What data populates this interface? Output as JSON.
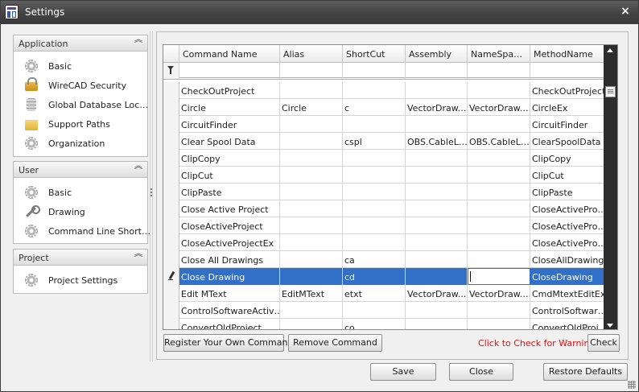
{
  "window": {
    "title": "Settings",
    "close_glyph": "×"
  },
  "sidebar": {
    "groups": [
      {
        "title": "Application",
        "items": [
          {
            "label": "Basic",
            "icon": "gear-icon"
          },
          {
            "label": "WireCAD Security",
            "icon": "lock-icon"
          },
          {
            "label": "Global Database Loc…",
            "icon": "database-icon"
          },
          {
            "label": "Support Paths",
            "icon": "folder-icon"
          },
          {
            "label": "Organization",
            "icon": "gear-icon"
          }
        ]
      },
      {
        "title": "User",
        "items": [
          {
            "label": "Basic",
            "icon": "gear-icon"
          },
          {
            "label": "Drawing",
            "icon": "wrench-icon"
          },
          {
            "label": "Command Line Short…",
            "icon": "gear-icon"
          }
        ]
      },
      {
        "title": "Project",
        "items": [
          {
            "label": "Project Settings",
            "icon": "gear-icon"
          }
        ]
      }
    ],
    "collapse_glyph": "︽"
  },
  "grid": {
    "columns": [
      "Command Name",
      "Alias",
      "ShortCut",
      "Assembly",
      "NameSpa…",
      "MethodName"
    ],
    "rows": [
      [
        "CheckOutProject",
        "",
        "",
        "",
        "",
        "CheckOutProject"
      ],
      [
        "Circle",
        "Circle",
        "c",
        "VectorDraw.…",
        "VectorDraw.…",
        "CircleEx"
      ],
      [
        "CircuitFinder",
        "",
        "",
        "",
        "",
        "CircuitFinder"
      ],
      [
        "Clear Spool Data",
        "",
        "cspl",
        "OBS.CableL…",
        "OBS.CableL…",
        "ClearSpoolData"
      ],
      [
        "ClipCopy",
        "",
        "",
        "",
        "",
        "ClipCopy"
      ],
      [
        "ClipCut",
        "",
        "",
        "",
        "",
        "ClipCut"
      ],
      [
        "ClipPaste",
        "",
        "",
        "",
        "",
        "ClipPaste"
      ],
      [
        "Close Active Project",
        "",
        "",
        "",
        "",
        "CloseActivePro…"
      ],
      [
        "CloseActiveProject",
        "",
        "",
        "",
        "",
        "CloseActivePro…"
      ],
      [
        "CloseActiveProjectEx",
        "",
        "",
        "",
        "",
        "CloseActivePro…"
      ],
      [
        "Close All Drawings",
        "",
        "ca",
        "",
        "",
        "CloseAllDrawings"
      ],
      [
        "Close Drawing",
        "",
        "cd",
        "",
        "",
        "CloseDrawing"
      ],
      [
        "Edit MText",
        "EditMText",
        "etxt",
        "VectorDraw.…",
        "VectorDraw.…",
        "CmdMtextEditEx"
      ],
      [
        "ControlSoftwareActiv…",
        "",
        "",
        "",
        "",
        "ControlSoftwar…"
      ],
      [
        "ConvertOldProject",
        "",
        "co",
        "",
        "",
        "ConvertOldProj…"
      ]
    ],
    "selected_row": 11
  },
  "actions": {
    "register_label": "Register Your Own Command",
    "remove_label": "Remove Command",
    "warning_text": "Click to Check for Warnings",
    "check_label": "Check"
  },
  "footer": {
    "save_label": "Save",
    "close_label": "Close",
    "restore_label": "Restore Defaults"
  },
  "colors": {
    "selection": "#3070c8",
    "warning": "#e01010",
    "titlebar": "#434343"
  }
}
